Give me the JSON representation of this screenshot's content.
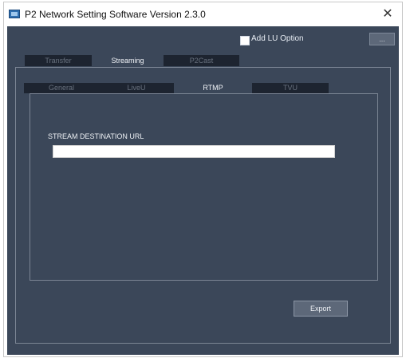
{
  "window": {
    "title": "P2 Network Setting Software  Version 2.3.0",
    "close_glyph": "✕"
  },
  "options": {
    "add_lu_label": "Add LU Option",
    "add_lu_checked": false,
    "small_button_label": "..."
  },
  "main_tabs": [
    {
      "label": "Transfer",
      "active": false
    },
    {
      "label": "Streaming",
      "active": true
    },
    {
      "label": "P2Cast",
      "active": false
    }
  ],
  "sub_tabs": [
    {
      "label": "General",
      "active": false
    },
    {
      "label": "LiveU",
      "active": false
    },
    {
      "label": "RTMP",
      "active": true
    },
    {
      "label": "TVU",
      "active": false
    }
  ],
  "rtmp": {
    "url_label": "STREAM DESTINATION URL",
    "url_value": "",
    "url_placeholder": ""
  },
  "footer": {
    "export_label": "Export"
  },
  "colors": {
    "panel_bg": "#3b4759",
    "inactive_tab_bg": "#1d2430",
    "button_bg": "#5d6879"
  }
}
